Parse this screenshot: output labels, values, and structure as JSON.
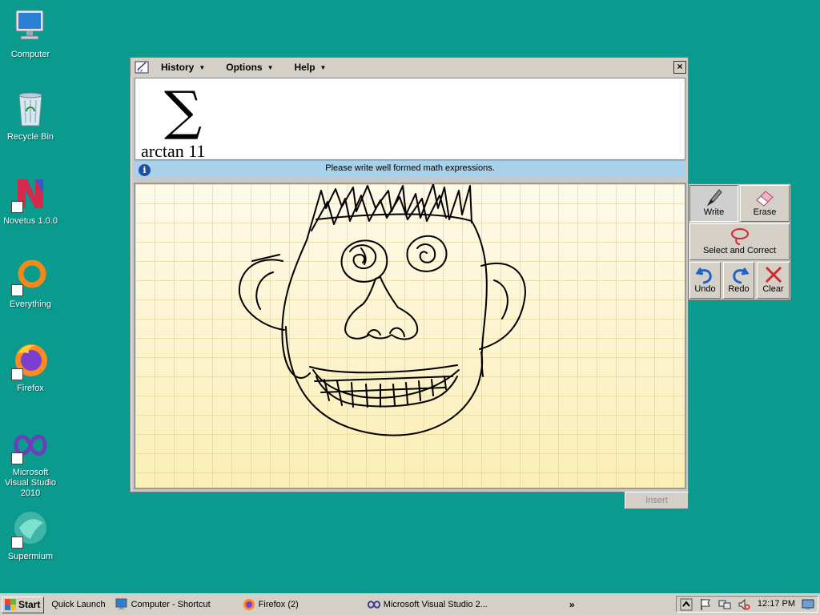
{
  "desktop": {
    "icons": [
      {
        "label": "Computer",
        "icon": "computer-icon"
      },
      {
        "label": "Recycle Bin",
        "icon": "recycle-bin-icon"
      },
      {
        "label": "Novetus 1.0.0",
        "icon": "novetus-icon"
      },
      {
        "label": "Everything",
        "icon": "everything-icon"
      },
      {
        "label": "Firefox",
        "icon": "firefox-icon"
      },
      {
        "label": "Microsoft Visual Studio 2010",
        "icon": "visual-studio-icon"
      },
      {
        "label": "Supermium",
        "icon": "supermium-icon"
      }
    ],
    "background_color": "#0b9a8e"
  },
  "math_panel": {
    "menus": [
      {
        "label": "History"
      },
      {
        "label": "Options"
      },
      {
        "label": "Help"
      }
    ],
    "close_label": "×",
    "preview": {
      "symbol": "∑",
      "expression": "arctan 11"
    },
    "info_message": "Please write well formed math expressions.",
    "tools": {
      "write": "Write",
      "erase": "Erase",
      "select_correct": "Select and Correct",
      "undo": "Undo",
      "redo": "Redo",
      "clear": "Clear"
    },
    "insert_label": "Insert"
  },
  "taskbar": {
    "start_label": "Start",
    "quick_launch": "Quick Launch",
    "tasks": [
      {
        "label": "Computer - Shortcut",
        "icon": "computer-icon"
      },
      {
        "label": "Firefox (2)",
        "icon": "firefox-icon"
      },
      {
        "label": "Microsoft Visual Studio 2...",
        "icon": "visual-studio-icon"
      }
    ],
    "overflow": "»",
    "clock": "12:17 PM"
  }
}
